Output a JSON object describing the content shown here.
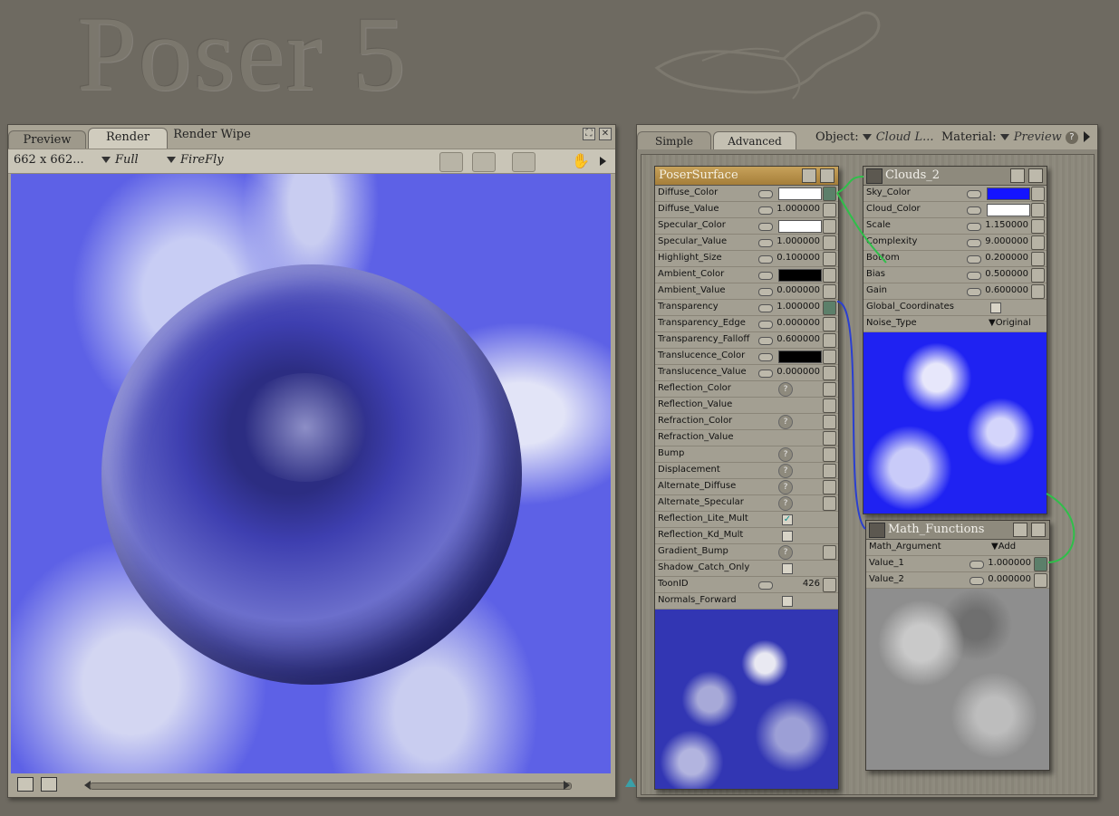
{
  "app_logo": "Poser 5",
  "render_window": {
    "tabs": [
      "Preview",
      "Render",
      "Render Wipe"
    ],
    "size_label": "662 x 662...",
    "quality": "Full",
    "renderer": "FireFly"
  },
  "material_room": {
    "tabs": [
      "Simple",
      "Advanced"
    ],
    "object_label": "Object:",
    "object_value": "Cloud L...",
    "material_label": "Material:",
    "material_value": "Preview",
    "help": "?"
  },
  "poser_surface": {
    "title": "PoserSurface",
    "rows": [
      {
        "label": "Diffuse_Color",
        "kind": "color",
        "color": "#ffffff",
        "plug": "conn"
      },
      {
        "label": "Diffuse_Value",
        "kind": "num",
        "value": "1.000000",
        "plug": "plain"
      },
      {
        "label": "Specular_Color",
        "kind": "color",
        "color": "#ffffff",
        "plug": "plain"
      },
      {
        "label": "Specular_Value",
        "kind": "num",
        "value": "1.000000",
        "plug": "plain"
      },
      {
        "label": "Highlight_Size",
        "kind": "num",
        "value": "0.100000",
        "plug": "plain"
      },
      {
        "label": "Ambient_Color",
        "kind": "color",
        "color": "#000000",
        "plug": "plain"
      },
      {
        "label": "Ambient_Value",
        "kind": "num",
        "value": "0.000000",
        "plug": "plain"
      },
      {
        "label": "Transparency",
        "kind": "num",
        "value": "1.000000",
        "plug": "conn"
      },
      {
        "label": "Transparency_Edge",
        "kind": "num",
        "value": "0.000000",
        "plug": "plain"
      },
      {
        "label": "Transparency_Falloff",
        "kind": "num",
        "value": "0.600000",
        "plug": "plain"
      },
      {
        "label": "Translucence_Color",
        "kind": "color",
        "color": "#000000",
        "plug": "plain"
      },
      {
        "label": "Translucence_Value",
        "kind": "num",
        "value": "0.000000",
        "plug": "plain"
      },
      {
        "label": "Reflection_Color",
        "kind": "q",
        "plug": "plain"
      },
      {
        "label": "Reflection_Value",
        "kind": "none",
        "plug": "plain"
      },
      {
        "label": "Refraction_Color",
        "kind": "q",
        "plug": "plain"
      },
      {
        "label": "Refraction_Value",
        "kind": "none",
        "plug": "plain"
      },
      {
        "label": "Bump",
        "kind": "q",
        "plug": "plain"
      },
      {
        "label": "Displacement",
        "kind": "q",
        "plug": "plain"
      },
      {
        "label": "Alternate_Diffuse",
        "kind": "q",
        "plug": "plain"
      },
      {
        "label": "Alternate_Specular",
        "kind": "q",
        "plug": "plain"
      },
      {
        "label": "Reflection_Lite_Mult",
        "kind": "check",
        "checked": true
      },
      {
        "label": "Reflection_Kd_Mult",
        "kind": "check",
        "checked": false
      },
      {
        "label": "Gradient_Bump",
        "kind": "q",
        "plug": "plain"
      },
      {
        "label": "Shadow_Catch_Only",
        "kind": "check",
        "checked": false
      },
      {
        "label": "ToonID",
        "kind": "num",
        "value": "426",
        "plug": "plain"
      },
      {
        "label": "Normals_Forward",
        "kind": "check",
        "checked": false
      }
    ]
  },
  "clouds": {
    "title": "Clouds_2",
    "rows": [
      {
        "label": "Sky_Color",
        "kind": "color",
        "color": "#1414ff",
        "plug": "plain"
      },
      {
        "label": "Cloud_Color",
        "kind": "color",
        "color": "#ffffff",
        "plug": "plain"
      },
      {
        "label": "Scale",
        "kind": "num",
        "value": "1.150000",
        "plug": "plain"
      },
      {
        "label": "Complexity",
        "kind": "num",
        "value": "9.000000",
        "plug": "plain"
      },
      {
        "label": "Bottom",
        "kind": "num",
        "value": "0.200000",
        "plug": "plain"
      },
      {
        "label": "Bias",
        "kind": "num",
        "value": "0.500000",
        "plug": "plain"
      },
      {
        "label": "Gain",
        "kind": "num",
        "value": "0.600000",
        "plug": "plain"
      },
      {
        "label": "Global_Coordinates",
        "kind": "check",
        "checked": false
      },
      {
        "label": "Noise_Type",
        "kind": "dd",
        "value": "Original"
      }
    ]
  },
  "math": {
    "title": "Math_Functions",
    "rows": [
      {
        "label": "Math_Argument",
        "kind": "dd",
        "value": "Add"
      },
      {
        "label": "Value_1",
        "kind": "num",
        "value": "1.000000",
        "plug": "conn"
      },
      {
        "label": "Value_2",
        "kind": "num",
        "value": "0.000000",
        "plug": "plain"
      }
    ]
  },
  "colors": {
    "wire_green": "#2fbf4a",
    "wire_blue": "#2a3fd0",
    "node_gold": "#b48c45",
    "sky_blue": "#5d61e6"
  }
}
